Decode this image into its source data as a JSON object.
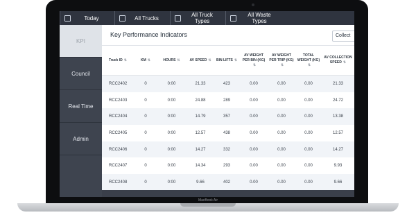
{
  "topbar": {
    "items": [
      {
        "label": "Today",
        "icon": "calendar-icon"
      },
      {
        "label": "All Trucks",
        "icon": "truck-icon"
      },
      {
        "label": "All Truck Types",
        "icon": "bus-icon"
      },
      {
        "label": "All Waste Types",
        "icon": "trash-icon"
      }
    ]
  },
  "sidebar": {
    "items": [
      {
        "label": "KPI",
        "active": true
      },
      {
        "label": "Council"
      },
      {
        "label": "Real Time"
      },
      {
        "label": "Admin"
      }
    ]
  },
  "main": {
    "title": "Key Performance Indicators",
    "collect_label": "Collect"
  },
  "table": {
    "headers": [
      "Truck ID",
      "KM",
      "HOURS",
      "AV SPEED",
      "BIN LIFTS",
      "AV WEIGHT PER BIN (KG)",
      "AV WEIGHT PER TRIP (KG)",
      "TOTAL WEIGHT (KG)",
      "AV COLLECTION SPEED"
    ],
    "rows": [
      [
        "RCC2402",
        "0",
        "0:00",
        "21.33",
        "423",
        "0.00",
        "0.00",
        "0.00",
        "21.33"
      ],
      [
        "RCC2403",
        "0",
        "0:00",
        "24.88",
        "289",
        "0.00",
        "0.00",
        "0.00",
        "24.72"
      ],
      [
        "RCC2404",
        "0",
        "0:00",
        "14.79",
        "357",
        "0.00",
        "0.00",
        "0.00",
        "13.38"
      ],
      [
        "RCC2405",
        "0",
        "0:00",
        "12.57",
        "438",
        "0.00",
        "0.00",
        "0.00",
        "12.57"
      ],
      [
        "RCC2406",
        "0",
        "0:00",
        "14.27",
        "332",
        "0.00",
        "0.00",
        "0.00",
        "14.27"
      ],
      [
        "RCC2407",
        "0",
        "0:00",
        "14.34",
        "293",
        "0.00",
        "0.00",
        "0.00",
        "9.93"
      ],
      [
        "RCC2408",
        "0",
        "0:00",
        "9.66",
        "402",
        "0.00",
        "0.00",
        "0.00",
        "9.66"
      ]
    ]
  },
  "device": {
    "brand": "MacBook Air"
  }
}
